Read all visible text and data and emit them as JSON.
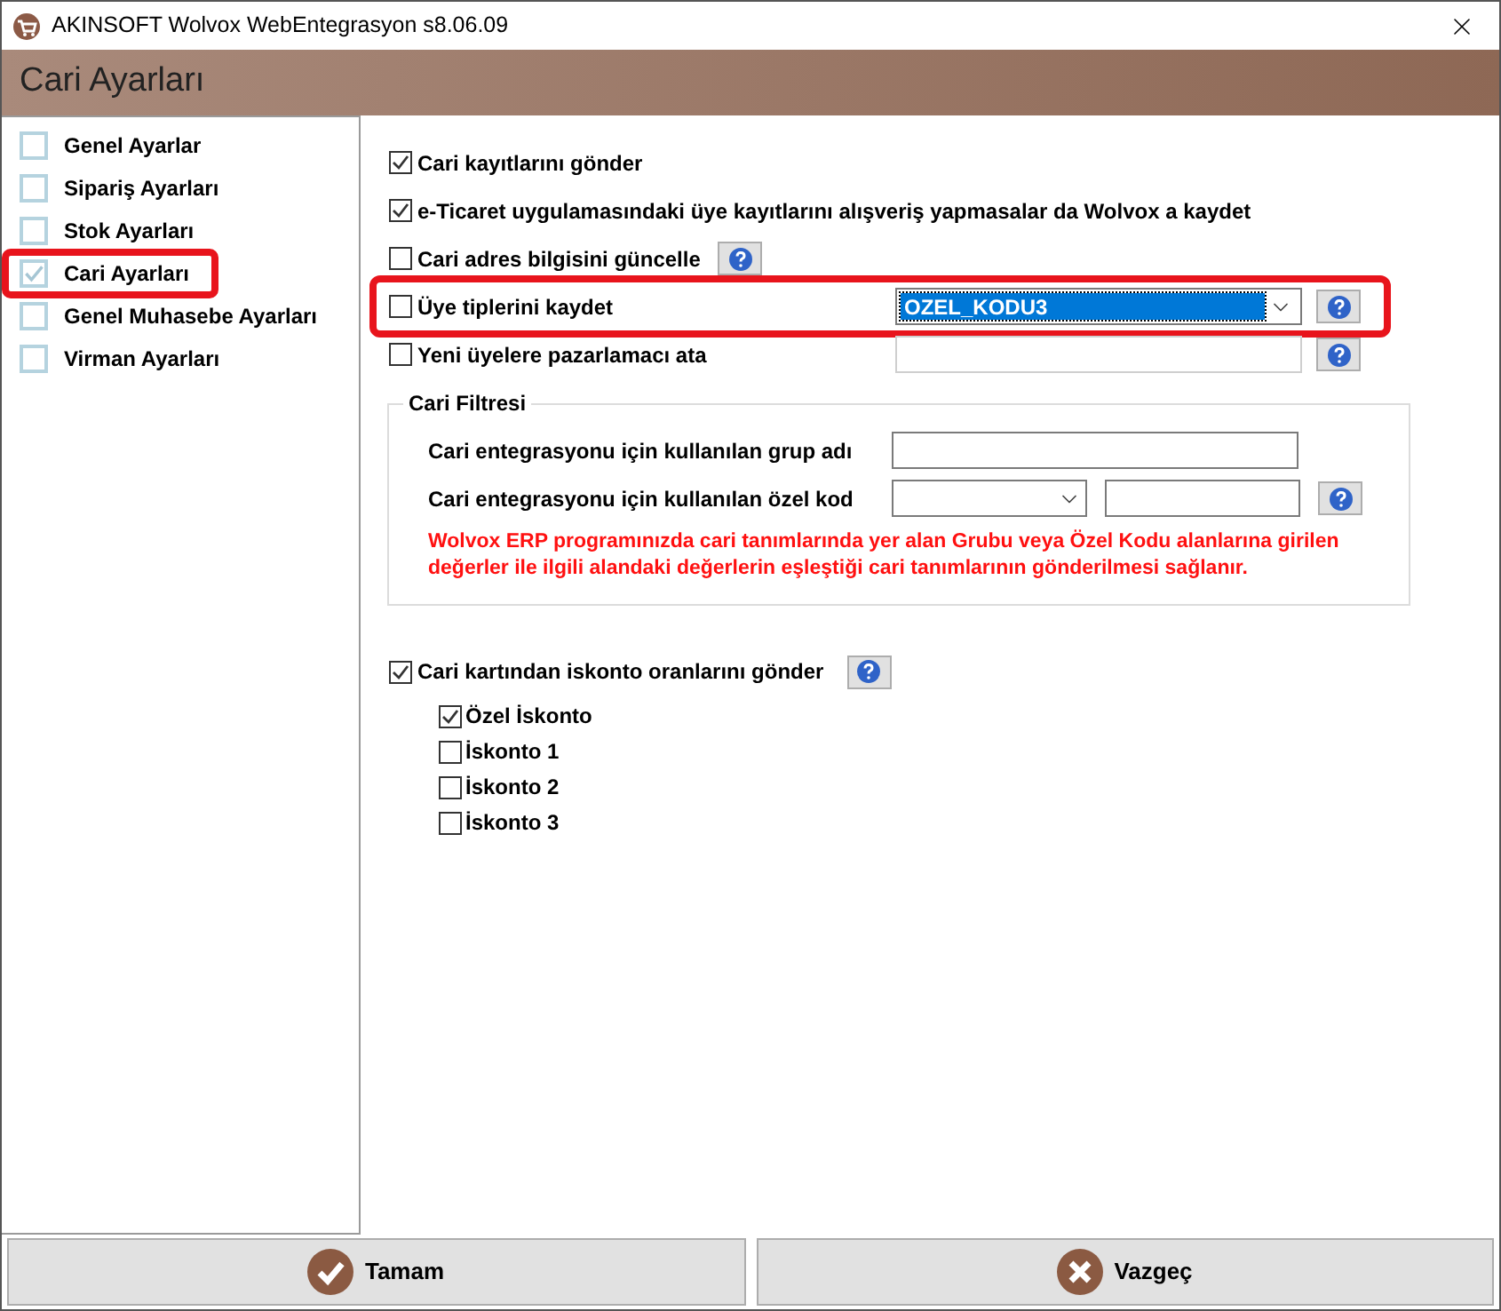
{
  "window": {
    "title": "AKINSOFT Wolvox WebEntegrasyon s8.06.09"
  },
  "header": {
    "title": "Cari Ayarları"
  },
  "sidebar": {
    "items": [
      {
        "label": "Genel Ayarlar",
        "checked": false
      },
      {
        "label": "Sipariş Ayarları",
        "checked": false
      },
      {
        "label": "Stok Ayarları",
        "checked": false
      },
      {
        "label": "Cari Ayarları",
        "checked": true,
        "highlighted": true
      },
      {
        "label": "Genel Muhasebe Ayarları",
        "checked": false
      },
      {
        "label": "Virman Ayarları",
        "checked": false
      }
    ]
  },
  "options": [
    {
      "kind": "check",
      "label": "Cari kayıtlarını gönder",
      "checked": true
    },
    {
      "kind": "check",
      "label": "e-Ticaret uygulamasındaki üye kayıtlarını alışveriş yapmasalar da Wolvox a kaydet",
      "checked": true
    },
    {
      "kind": "check_help",
      "label": "Cari adres bilgisini güncelle",
      "checked": false
    },
    {
      "kind": "check_select",
      "label": "Üye tiplerini kaydet",
      "checked": false,
      "value": "OZEL_KODU3",
      "highlighted": true
    },
    {
      "kind": "check_input",
      "label": "Yeni üyelere pazarlamacı ata",
      "checked": false
    }
  ],
  "filter": {
    "title": "Cari Filtresi",
    "rows": [
      {
        "kind": "input",
        "label": "Cari entegrasyonu için kullanılan grup adı"
      },
      {
        "kind": "select_input",
        "label": "Cari entegrasyonu için kullanılan özel kod"
      }
    ],
    "note": "Wolvox ERP programınızda cari tanımlarında yer alan Grubu veya Özel Kodu alanlarına girilen değerler ile ilgili alandaki değerlerin eşleştiği cari tanımlarının gönderilmesi sağlanır."
  },
  "discount": {
    "label": "Cari kartından iskonto oranlarını gönder",
    "checked": true,
    "items": [
      {
        "label": "Özel İskonto",
        "checked": true
      },
      {
        "label": "İskonto 1",
        "checked": false
      },
      {
        "label": "İskonto 2",
        "checked": false
      },
      {
        "label": "İskonto 3",
        "checked": false
      }
    ]
  },
  "buttons": [
    {
      "kind": "ok",
      "label": "Tamam"
    },
    {
      "kind": "cancel",
      "label": "Vazgeç"
    }
  ]
}
